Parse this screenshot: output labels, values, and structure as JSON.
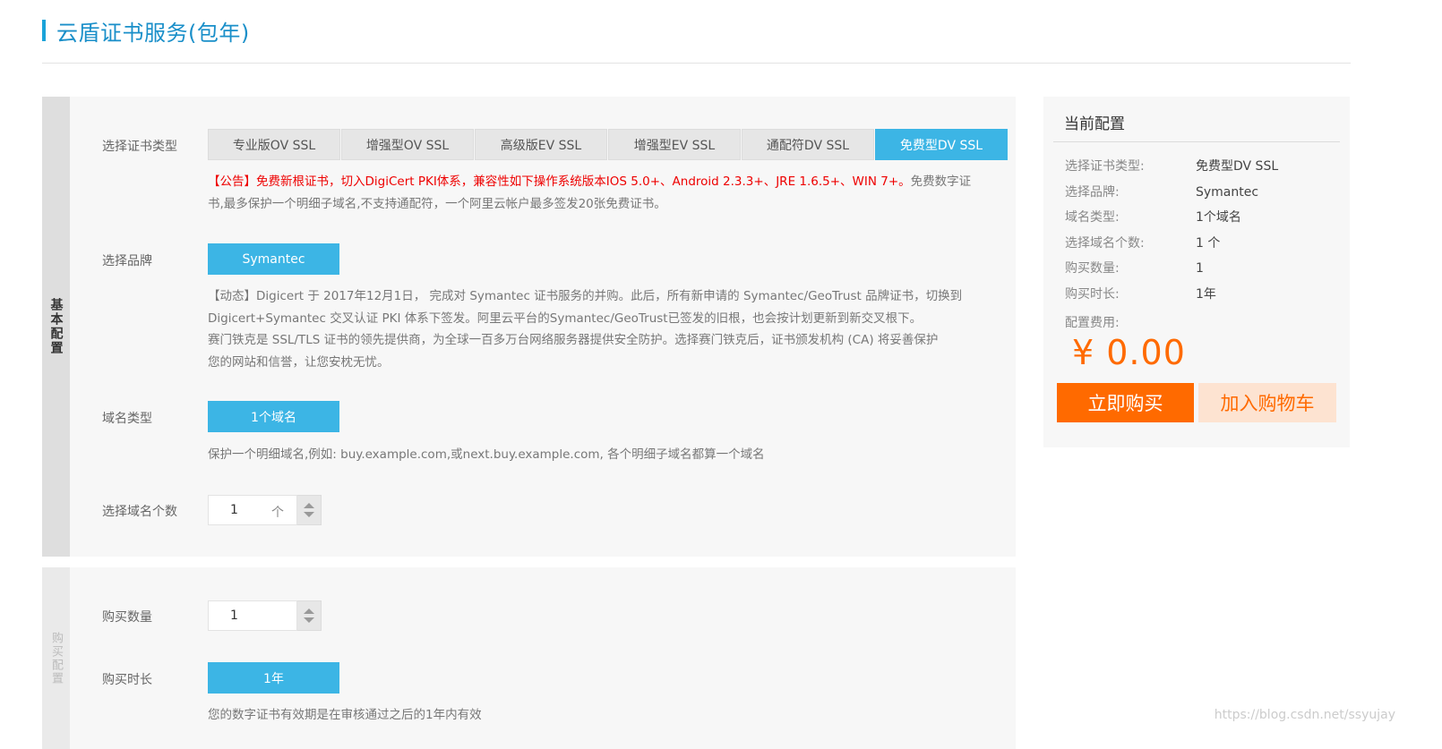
{
  "page": {
    "title": "云盾证书服务(包年)"
  },
  "basic": {
    "side_label": "基本配置",
    "cert_type_label": "选择证书类型",
    "cert_types": [
      "专业版OV SSL",
      "增强型OV SSL",
      "高级版EV SSL",
      "增强型EV SSL",
      "通配符DV SSL",
      "免费型DV SSL"
    ],
    "cert_type_selected": "免费型DV SSL",
    "notice_red": "【公告】免费新根证书，切入DigiCert PKI体系，兼容性如下操作系统版本IOS 5.0+、Android 2.3.3+、JRE 1.6.5+、WIN 7+。",
    "notice_gray_1": "免费数字证",
    "notice_gray_2": "书,最多保护一个明细子域名,不支持通配符，一个阿里云帐户最多签发20张免费证书。",
    "brand_label": "选择品牌",
    "brand_button": "Symantec",
    "brand_desc": [
      "【动态】Digicert 于 2017年12月1日， 完成对 Symantec 证书服务的并购。此后，所有新申请的 Symantec/GeoTrust 品牌证书，切换到",
      "Digicert+Symantec 交叉认证 PKI 体系下签发。阿里云平台的Symantec/GeoTrust已签发的旧根，也会按计划更新到新交叉根下。",
      "赛门铁克是 SSL/TLS 证书的领先提供商，为全球一百多万台网络服务器提供安全防护。选择赛门铁克后，证书颁发机构 (CA) 将妥善保护",
      "您的网站和信誉，让您安枕无忧。"
    ],
    "domain_type_label": "域名类型",
    "domain_type_button": "1个域名",
    "domain_type_desc": "保护一个明细域名,例如: buy.example.com,或next.buy.example.com, 各个明细子域名都算一个域名",
    "domain_count_label": "选择域名个数",
    "domain_count_value": "1",
    "domain_count_unit": "个"
  },
  "purchase": {
    "side_label": "购买配置",
    "qty_label": "购买数量",
    "qty_value": "1",
    "duration_label": "购买时长",
    "duration_button": "1年",
    "duration_desc": "您的数字证书有效期是在审核通过之后的1年内有效"
  },
  "summary": {
    "title": "当前配置",
    "rows": [
      {
        "k": "选择证书类型:",
        "v": "免费型DV SSL"
      },
      {
        "k": "选择品牌:",
        "v": "Symantec"
      },
      {
        "k": "域名类型:",
        "v": "1个域名"
      },
      {
        "k": "选择域名个数:",
        "v": "1 个"
      },
      {
        "k": "购买数量:",
        "v": "1"
      },
      {
        "k": "购买时长:",
        "v": "1年"
      }
    ],
    "fee_label": "配置费用:",
    "price": "¥ 0.00",
    "buy_button": "立即购买",
    "cart_button": "加入购物车"
  },
  "watermark": "https://blog.csdn.net/ssyujay",
  "colors": {
    "accent": "#3cb5e5",
    "orange": "#ff6a00",
    "title_blue": "#1a8fc9",
    "notice_red": "#ee0000"
  }
}
